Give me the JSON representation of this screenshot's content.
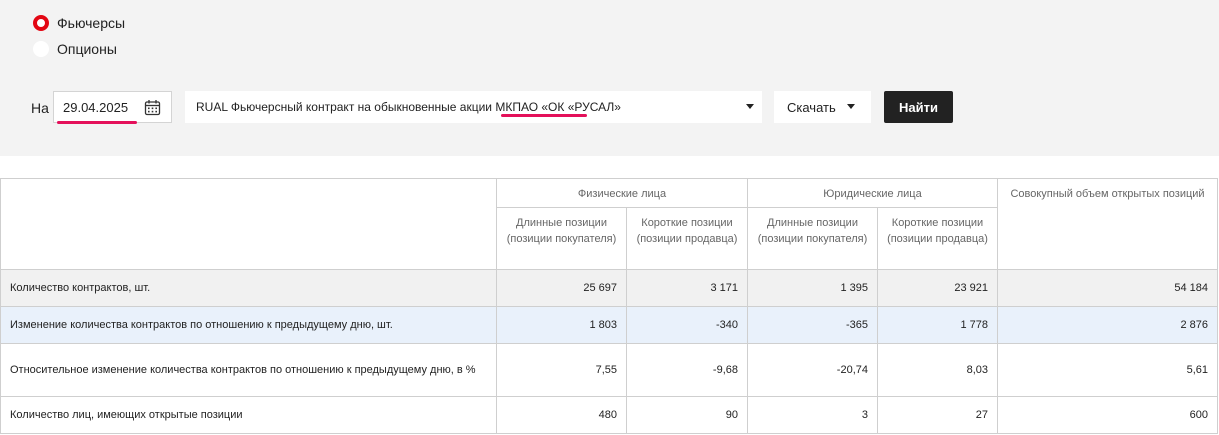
{
  "filters": {
    "options": [
      {
        "label": "Фьючерсы",
        "selected": true
      },
      {
        "label": "Опционы",
        "selected": false
      }
    ],
    "date_label": "На",
    "date_value": "29.04.2025",
    "contract": "RUAL Фьючерсный контракт на обыкновенные акции МКПАО «ОК «РУСАЛ»",
    "download_label": "Скачать",
    "find_label": "Найти",
    "accent_color": "#e30613",
    "underline_color": "#e4105a"
  },
  "table": {
    "groups": {
      "physical": "Физические лица",
      "legal": "Юридические лица",
      "total": "Совокупный объем открытых позиций"
    },
    "sub_headers": {
      "long": "Длинные позиции (позиции покупателя)",
      "short": "Короткие позиции (позиции продавца)"
    },
    "rows": [
      {
        "label": "Количество контрактов, шт.",
        "phys_long": "25 697",
        "phys_short": "3 171",
        "legal_long": "1 395",
        "legal_short": "23 921",
        "total": "54 184"
      },
      {
        "label": "Изменение количества контрактов по отношению к предыдущему дню, шт.",
        "phys_long": "1 803",
        "phys_short": "-340",
        "legal_long": "-365",
        "legal_short": "1 778",
        "total": "2 876"
      },
      {
        "label": "Относительное изменение количества контрактов по отношению к предыдущему дню, в %",
        "phys_long": "7,55",
        "phys_short": "-9,68",
        "legal_long": "-20,74",
        "legal_short": "8,03",
        "total": "5,61"
      },
      {
        "label": "Количество лиц, имеющих открытые позиции",
        "phys_long": "480",
        "phys_short": "90",
        "legal_long": "3",
        "legal_short": "27",
        "total": "600"
      }
    ]
  }
}
